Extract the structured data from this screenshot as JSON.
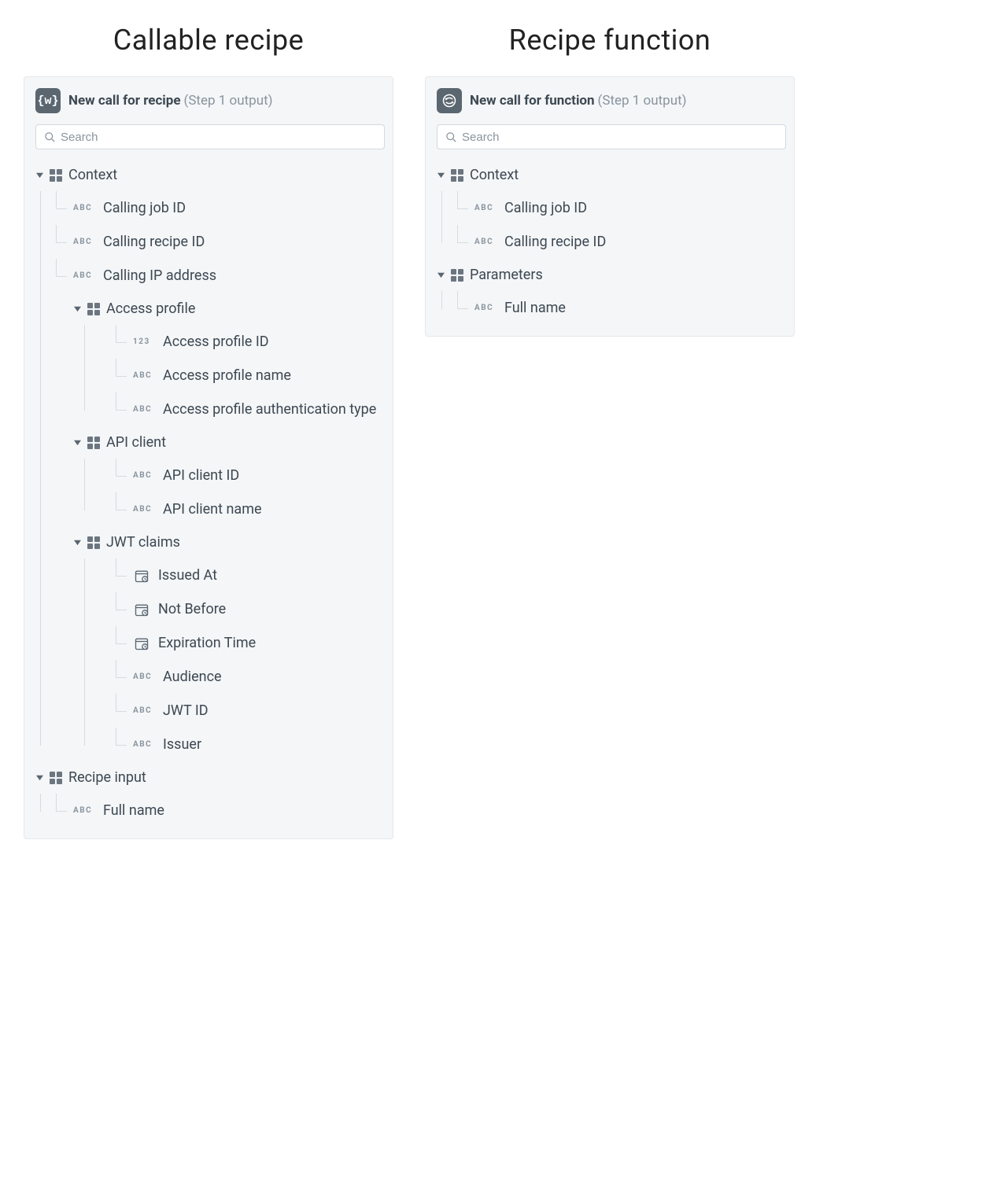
{
  "left": {
    "heading": "Callable recipe",
    "badge_text": "{w}",
    "header_title": "New call for recipe",
    "header_subtitle": "(Step 1 output)",
    "search_placeholder": "Search",
    "sections": {
      "context": {
        "label": "Context",
        "calling_job_id": "Calling job ID",
        "calling_recipe_id": "Calling recipe ID",
        "calling_ip_address": "Calling IP address",
        "access_profile": {
          "label": "Access profile",
          "id": "Access profile ID",
          "name": "Access profile name",
          "auth_type": "Access profile authentication type"
        },
        "api_client": {
          "label": "API client",
          "id": "API client ID",
          "name": "API client name"
        },
        "jwt_claims": {
          "label": "JWT claims",
          "issued_at": "Issued At",
          "not_before": "Not Before",
          "expiration_time": "Expiration Time",
          "audience": "Audience",
          "jwt_id": "JWT ID",
          "issuer": "Issuer"
        }
      },
      "recipe_input": {
        "label": "Recipe input",
        "full_name": "Full name"
      }
    }
  },
  "right": {
    "heading": "Recipe function",
    "header_title": "New call for function",
    "header_subtitle": "(Step 1 output)",
    "search_placeholder": "Search",
    "sections": {
      "context": {
        "label": "Context",
        "calling_job_id": "Calling job ID",
        "calling_recipe_id": "Calling recipe ID"
      },
      "parameters": {
        "label": "Parameters",
        "full_name": "Full name"
      }
    }
  },
  "type_labels": {
    "abc": "ABC",
    "num": "123"
  }
}
